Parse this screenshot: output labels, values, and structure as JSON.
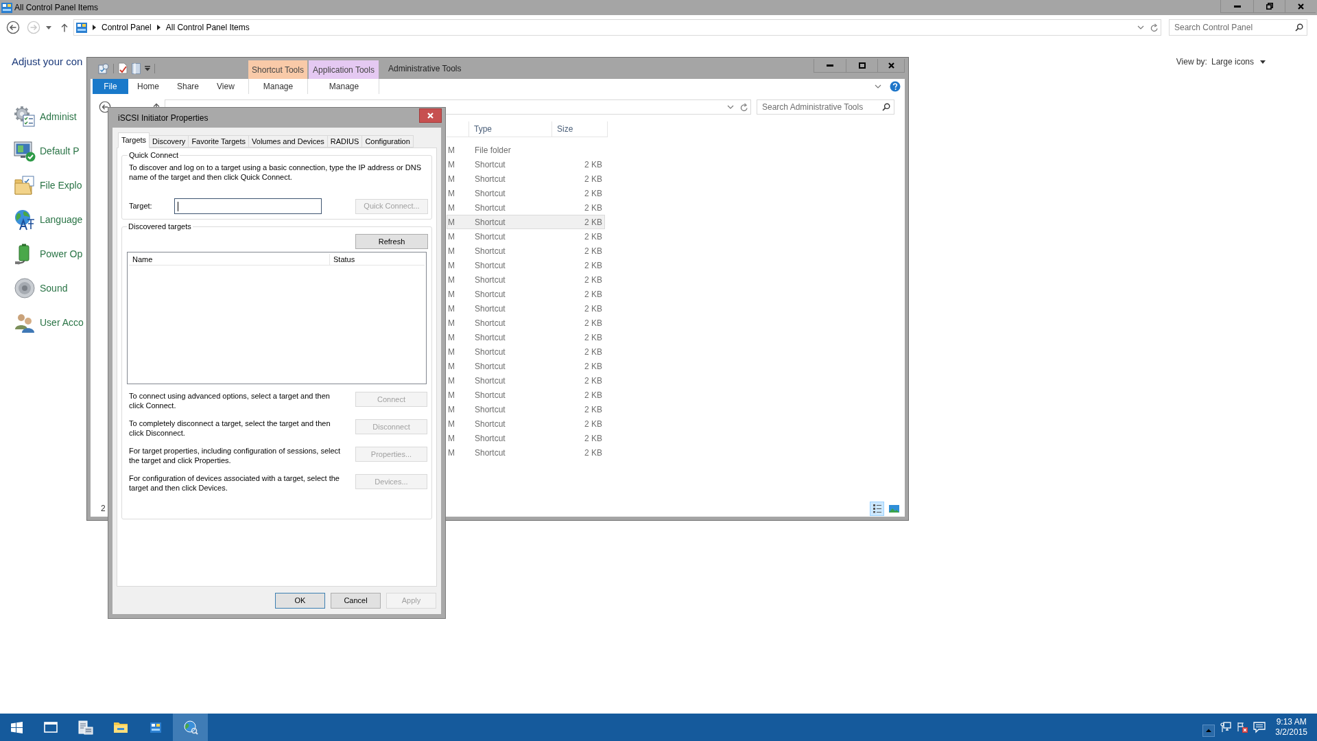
{
  "control_panel": {
    "title": "All Control Panel Items",
    "address": {
      "crumbs": [
        "Control Panel",
        "All Control Panel Items"
      ]
    },
    "search": {
      "placeholder": "Search Control Panel"
    },
    "heading": "Adjust your con",
    "view_by": {
      "label": "View by:",
      "value": "Large icons"
    },
    "items": [
      "Administ",
      "Default P",
      "File Explo",
      "Language",
      "Power Op",
      "Sound",
      "User Acco"
    ]
  },
  "explorer": {
    "title": "Administrative Tools",
    "context_groups": [
      {
        "label": "Shortcut Tools",
        "color": "#f9caa8",
        "tab": "Manage"
      },
      {
        "label": "Application Tools",
        "color": "#e5c9f2",
        "tab": "Manage"
      }
    ],
    "tabs": [
      {
        "label": "File",
        "kind": "file"
      },
      {
        "label": "Home",
        "kind": "plain"
      },
      {
        "label": "Share",
        "kind": "plain"
      },
      {
        "label": "View",
        "kind": "plain"
      }
    ],
    "search": {
      "placeholder": "Search Administrative Tools"
    },
    "columns": [
      {
        "label": "Type"
      },
      {
        "label": "Size"
      }
    ],
    "rows": [
      {
        "column_1": "M",
        "type": "File folder",
        "selected": false
      },
      {
        "column_1": "M",
        "type": "Shortcut",
        "size": "2 KB",
        "selected": false
      },
      {
        "column_1": "M",
        "type": "Shortcut",
        "size": "2 KB",
        "selected": false
      },
      {
        "column_1": "M",
        "type": "Shortcut",
        "size": "2 KB",
        "selected": false
      },
      {
        "column_1": "M",
        "type": "Shortcut",
        "size": "2 KB",
        "selected": false
      },
      {
        "column_1": "M",
        "type": "Shortcut",
        "size": "2 KB",
        "selected": true
      },
      {
        "column_1": "M",
        "type": "Shortcut",
        "size": "2 KB",
        "selected": false
      },
      {
        "column_1": "M",
        "type": "Shortcut",
        "size": "2 KB",
        "selected": false
      },
      {
        "column_1": "M",
        "type": "Shortcut",
        "size": "2 KB",
        "selected": false
      },
      {
        "column_1": "M",
        "type": "Shortcut",
        "size": "2 KB",
        "selected": false
      },
      {
        "column_1": "M",
        "type": "Shortcut",
        "size": "2 KB",
        "selected": false
      },
      {
        "column_1": "M",
        "type": "Shortcut",
        "size": "2 KB",
        "selected": false
      },
      {
        "column_1": "M",
        "type": "Shortcut",
        "size": "2 KB",
        "selected": false
      },
      {
        "column_1": "M",
        "type": "Shortcut",
        "size": "2 KB",
        "selected": false
      },
      {
        "column_1": "M",
        "type": "Shortcut",
        "size": "2 KB",
        "selected": false
      },
      {
        "column_1": "M",
        "type": "Shortcut",
        "size": "2 KB",
        "selected": false
      },
      {
        "column_1": "M",
        "type": "Shortcut",
        "size": "2 KB",
        "selected": false
      },
      {
        "column_1": "M",
        "type": "Shortcut",
        "size": "2 KB",
        "selected": false
      },
      {
        "column_1": "M",
        "type": "Shortcut",
        "size": "2 KB",
        "selected": false
      },
      {
        "column_1": "M",
        "type": "Shortcut",
        "size": "2 KB",
        "selected": false
      },
      {
        "column_1": "M",
        "type": "Shortcut",
        "size": "2 KB",
        "selected": false
      },
      {
        "column_1": "M",
        "type": "Shortcut",
        "size": "2 KB",
        "selected": false
      }
    ],
    "status_bar": {
      "item_count": "2"
    },
    "views": [
      {
        "selected": true
      },
      {
        "selected": false
      }
    ]
  },
  "dialog": {
    "title": "iSCSI Initiator Properties",
    "tabs": [
      {
        "label": "Targets",
        "selected": true
      },
      {
        "label": "Discovery",
        "selected": false
      },
      {
        "label": "Favorite Targets",
        "selected": false
      },
      {
        "label": "Volumes and Devices",
        "selected": false
      },
      {
        "label": "RADIUS",
        "selected": false
      },
      {
        "label": "Configuration",
        "selected": false
      }
    ],
    "quick_connect": {
      "title": "Quick Connect",
      "description": "To discover and log on to a target using a basic connection, type the IP address or DNS name of the target and then click Quick Connect.",
      "target_label": "Target:",
      "target_focused": true,
      "button": {
        "label": "Quick Connect...",
        "disabled": true
      }
    },
    "discovered": {
      "title": "Discovered targets",
      "refresh": {
        "label": "Refresh",
        "disabled": false
      },
      "columns": [
        "Name",
        "Status"
      ],
      "actions": [
        {
          "text": "To connect using advanced options, select a target and then click Connect.",
          "button": {
            "label": "Connect",
            "disabled": true
          }
        },
        {
          "text": "To completely disconnect a target, select the target and then click Disconnect.",
          "button": {
            "label": "Disconnect",
            "disabled": true
          }
        },
        {
          "text": "For target properties, including configuration of sessions, select the target and click Properties.",
          "button": {
            "label": "Properties...",
            "disabled": true
          }
        },
        {
          "text": "For configuration of devices associated with a target, select the target and then click Devices.",
          "button": {
            "label": "Devices...",
            "disabled": true
          }
        }
      ]
    },
    "buttons": [
      {
        "label": "OK",
        "default": true,
        "disabled": false
      },
      {
        "label": "Cancel",
        "default": false,
        "disabled": false
      },
      {
        "label": "Apply",
        "default": false,
        "disabled": true
      }
    ]
  },
  "taskbar": {
    "apps": [
      {
        "active": false
      },
      {
        "active": false
      },
      {
        "active": false
      },
      {
        "active": false
      },
      {
        "active": true
      }
    ],
    "clock": {
      "time": "9:13 AM",
      "date": "3/2/2015"
    }
  }
}
